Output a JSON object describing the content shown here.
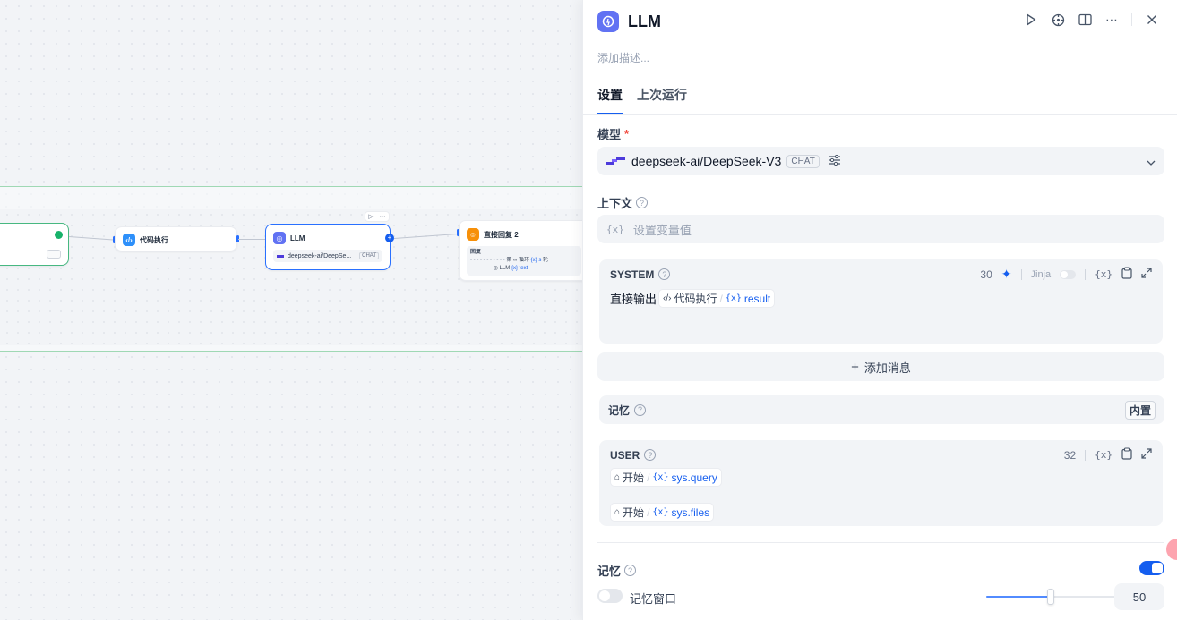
{
  "canvas": {
    "nodes": {
      "code": {
        "title": "代码执行"
      },
      "llm": {
        "title": "LLM",
        "model": "deepseek-ai/DeepSe...",
        "badge": "CHAT"
      },
      "answer": {
        "title": "直接回复 2",
        "reply_label": "回复",
        "line1_prefix": "第",
        "line1_iter": "循环",
        "line1_var": "{x} s",
        "line1_suffix": "轮",
        "line2_node": "LLM",
        "line2_var": "{x} text"
      }
    }
  },
  "panel": {
    "title": "LLM",
    "description_placeholder": "添加描述...",
    "tabs": [
      {
        "label": "设置"
      },
      {
        "label": "上次运行"
      }
    ],
    "model": {
      "label": "模型",
      "required_mark": "*",
      "name": "deepseek-ai/DeepSeek-V3",
      "badge": "CHAT"
    },
    "context": {
      "label": "上下文",
      "placeholder": "设置变量值"
    },
    "system": {
      "role": "SYSTEM",
      "count": "30",
      "jinja": "Jinja",
      "text": "直接输出",
      "chip_node": "代码执行",
      "chip_var": "result"
    },
    "add_message": "添加消息",
    "memory_row": {
      "label": "记忆",
      "badge": "内置"
    },
    "user": {
      "role": "USER",
      "count": "32",
      "chip1_node": "开始",
      "chip1_var": "sys.query",
      "chip2_node": "开始",
      "chip2_var": "sys.files"
    },
    "memory": {
      "label": "记忆",
      "window_label": "记忆窗口",
      "window_value": "50",
      "window_fraction": 0.5
    }
  }
}
